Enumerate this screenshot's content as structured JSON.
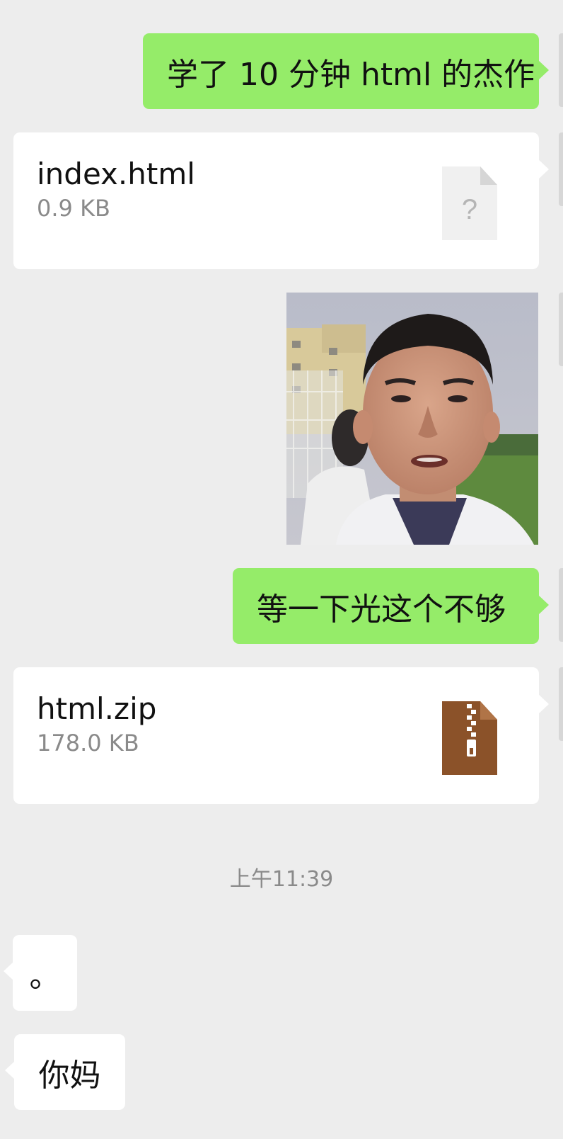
{
  "chat": {
    "messages": {
      "m1_text": "学了 10 分钟 html 的杰作",
      "m2_file_name": "index.html",
      "m2_file_size": "0.9 KB",
      "m2_file_icon": "unknown-file-icon",
      "m3_photo": "selfie-photo",
      "m4_text": "等一下光这个不够",
      "m5_file_name": "html.zip",
      "m5_file_size": "178.0 KB",
      "m5_file_icon": "zip-archive-icon",
      "m6_text": "。",
      "m7_text": "你妈"
    },
    "time_separator": "上午11:39"
  },
  "colors": {
    "background": "#ededed",
    "sent_bubble": "#95ec69",
    "received_bubble": "#ffffff",
    "zip_icon": "#8b5229",
    "secondary_text": "#8a8a8a"
  }
}
